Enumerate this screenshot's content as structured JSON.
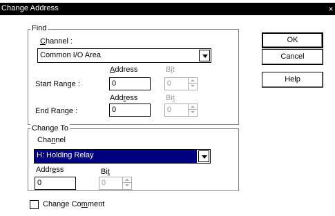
{
  "title": "Change Address",
  "close_glyph": "×",
  "find": {
    "legend": "Find",
    "channel_label_prefix": "",
    "channel_label_mnemonic": "C",
    "channel_label_rest": "hannel :",
    "channel_value": "Common I/O Area",
    "address_header_mnemonic": "A",
    "address_header_rest": "ddress",
    "bit_header_prefix": "B",
    "bit_header_mnemonic": "i",
    "bit_header_rest": "t",
    "start_range_label": "Start Range :",
    "start_address": "0",
    "start_bit": "0",
    "address_header2_prefix": "Add",
    "address_header2_mnemonic": "r",
    "address_header2_rest": "ess",
    "bit_header2_prefix": "Bi",
    "bit_header2_mnemonic": "t",
    "bit_header2_rest": "",
    "end_range_label": "End Range :",
    "end_address": "0",
    "end_bit": "0"
  },
  "change_to": {
    "legend": "Change To",
    "channel_label_prefix": "Cha",
    "channel_label_mnemonic": "n",
    "channel_label_rest": "nel",
    "channel_value": "H: Holding Relay",
    "address_label_prefix": "Addr",
    "address_label_mnemonic": "e",
    "address_label_rest": "ss",
    "bit_label_prefix": "Bi",
    "bit_label_mnemonic": "t",
    "bit_label_rest": "",
    "address_value": "0",
    "bit_value": "0"
  },
  "change_comment": {
    "label_prefix": "Change Co",
    "label_mnemonic": "m",
    "label_rest": "ment",
    "checked": false
  },
  "buttons": {
    "ok": "OK",
    "cancel": "Cancel",
    "help": "Help"
  }
}
